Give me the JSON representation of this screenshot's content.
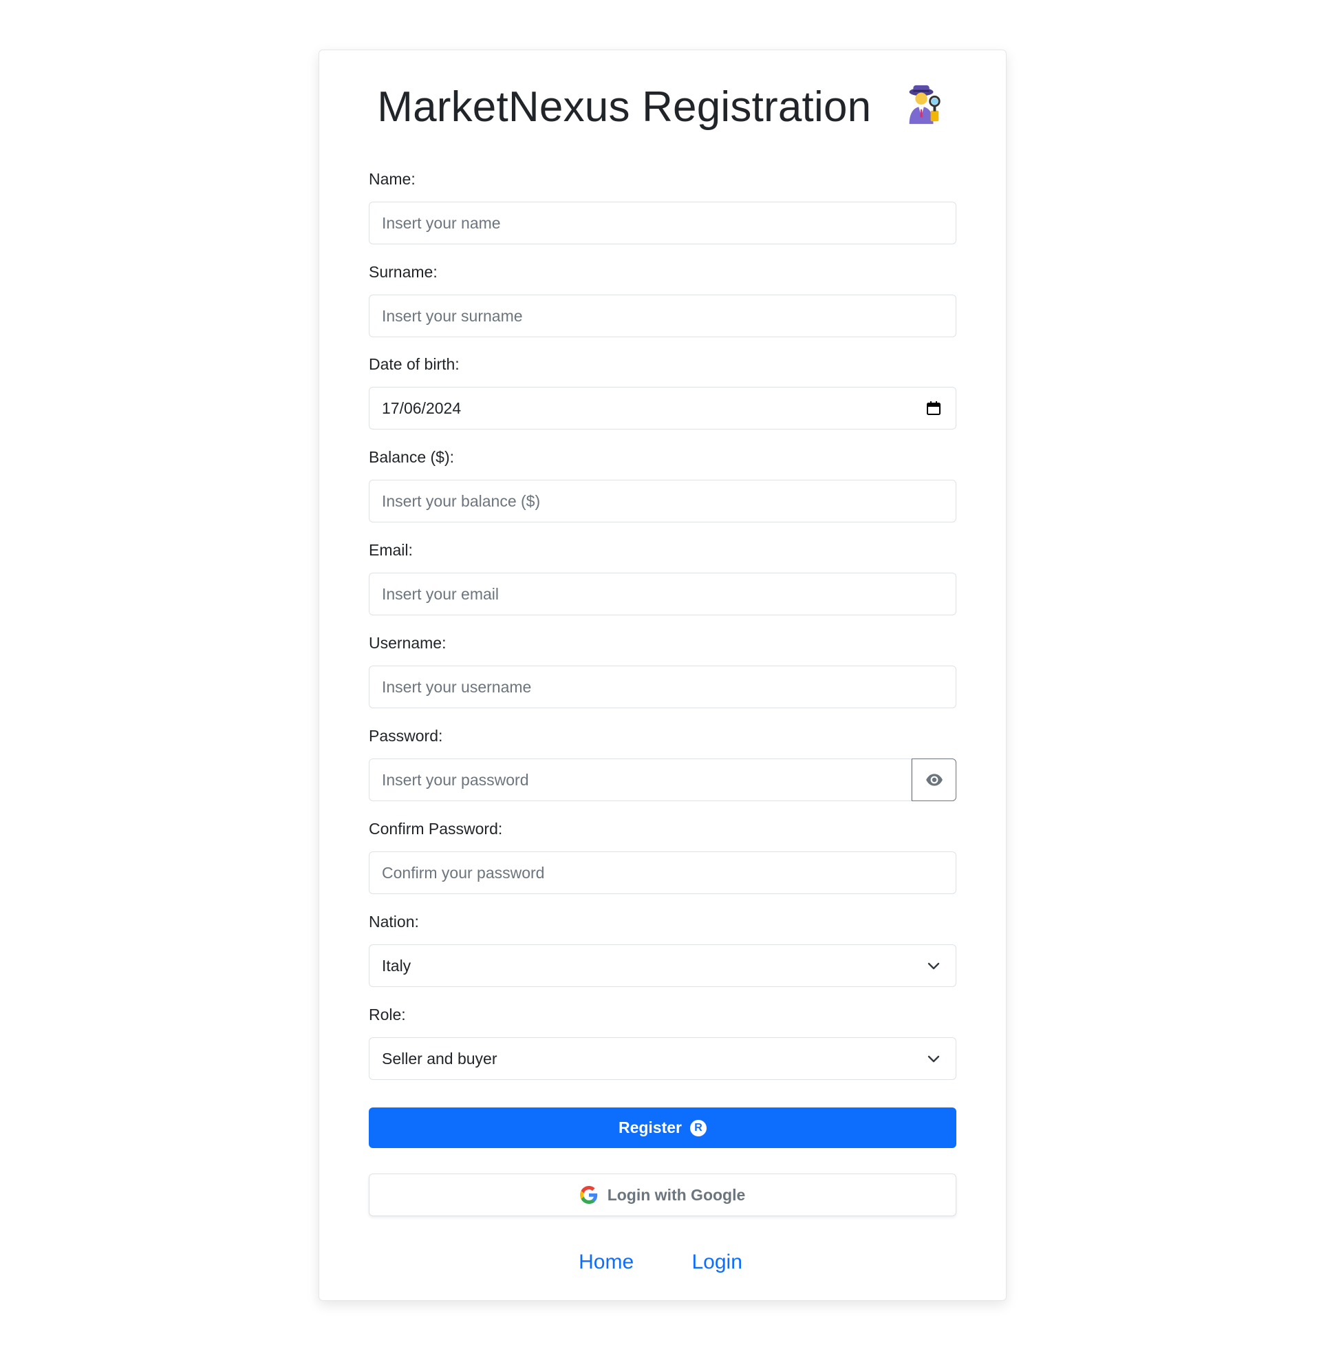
{
  "title": "MarketNexus Registration",
  "title_emoji": "detective-woman",
  "fields": {
    "name": {
      "label": "Name:",
      "placeholder": "Insert your name"
    },
    "surname": {
      "label": "Surname:",
      "placeholder": "Insert your surname"
    },
    "dob": {
      "label": "Date of birth:",
      "value": "17/06/2024"
    },
    "balance": {
      "label": "Balance ($):",
      "placeholder": "Insert your balance ($)"
    },
    "email": {
      "label": "Email:",
      "placeholder": "Insert your email"
    },
    "username": {
      "label": "Username:",
      "placeholder": "Insert your username"
    },
    "password": {
      "label": "Password:",
      "placeholder": "Insert your password"
    },
    "confirm_password": {
      "label": "Confirm Password:",
      "placeholder": "Confirm your password"
    },
    "nation": {
      "label": "Nation:",
      "value": "Italy"
    },
    "role": {
      "label": "Role:",
      "value": "Seller and buyer"
    }
  },
  "buttons": {
    "register": "Register",
    "register_icon_letter": "R",
    "google": "Login with Google"
  },
  "links": {
    "home": "Home",
    "login": "Login"
  },
  "colors": {
    "primary": "#0d6efd",
    "text": "#212529",
    "muted": "#6c757d",
    "border": "#dee2e6"
  }
}
